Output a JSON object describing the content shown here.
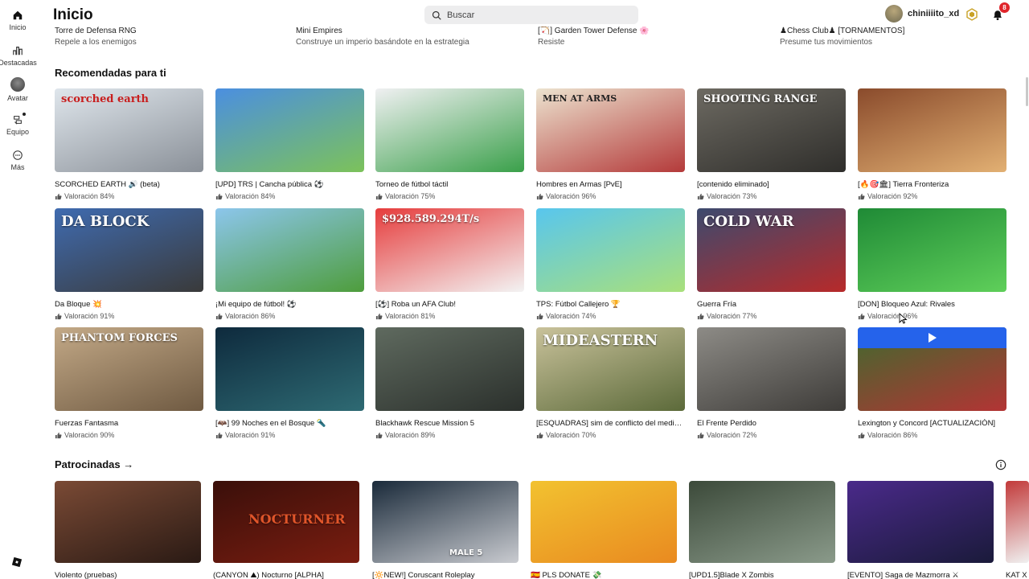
{
  "sidebar": {
    "items": [
      {
        "label": "Inicio",
        "icon": "home-icon"
      },
      {
        "label": "Destacadas",
        "icon": "chart-icon"
      },
      {
        "label": "Avatar",
        "icon": "avatar-icon"
      },
      {
        "label": "Equipo",
        "icon": "team-icon"
      },
      {
        "label": "Más",
        "icon": "more-icon"
      }
    ]
  },
  "header": {
    "title": "Inicio",
    "search_placeholder": "Buscar",
    "username": "chiniiiito_xd",
    "notification_count": "8"
  },
  "top_row": [
    {
      "title": "Torre de Defensa RNG",
      "subtitle": "Repele a los enemigos"
    },
    {
      "title": "Mini Empires",
      "subtitle": "Construye un imperio basándote en la estrategia"
    },
    {
      "title": "[🏹] Garden Tower Defense 🌸",
      "subtitle": "Resiste"
    },
    {
      "title": "♟Chess Club♟ [TORNAMENTOS]",
      "subtitle": "Presume tus movimientos"
    }
  ],
  "recommended": {
    "heading": "Recomendadas para ti",
    "cards": [
      {
        "title": "SCORCHED EARTH 🔊 (beta)",
        "rating": "Valoración 84%",
        "thumb_text": "scorched earth",
        "colors": [
          "#dfe6ec",
          "#8a9098"
        ]
      },
      {
        "title": "[UPD] TRS | Cancha pública ⚽",
        "rating": "Valoración 84%",
        "thumb_text": "",
        "colors": [
          "#4b8fe0",
          "#7cc25a"
        ]
      },
      {
        "title": "Torneo de fútbol táctil",
        "rating": "Valoración 75%",
        "thumb_text": "",
        "colors": [
          "#f0f0f2",
          "#3aa04a"
        ]
      },
      {
        "title": "Hombres en Armas [PvE]",
        "rating": "Valoración 96%",
        "thumb_text": "MEN AT ARMS",
        "colors": [
          "#ece3cf",
          "#b43a3a"
        ]
      },
      {
        "title": "[contenido eliminado]",
        "rating": "Valoración 73%",
        "thumb_text": "SHOOTING RANGE",
        "colors": [
          "#6d6a62",
          "#2f2e2b"
        ]
      },
      {
        "title": "[🔥🎯🏛] Tierra Fronteriza",
        "rating": "Valoración 92%",
        "thumb_text": "",
        "colors": [
          "#8a4b2c",
          "#e2b073"
        ]
      },
      {
        "title": "Da Bloque 💥",
        "rating": "Valoración 91%",
        "thumb_text": "DA BLOCK",
        "colors": [
          "#3f6bb0",
          "#3a3a3a"
        ]
      },
      {
        "title": "¡Mi equipo de fútbol! ⚽",
        "rating": "Valoración 86%",
        "thumb_text": "",
        "colors": [
          "#8cc6ec",
          "#4e9d3c"
        ]
      },
      {
        "title": "[⚽] Roba un AFA Club!",
        "rating": "Valoración 81%",
        "thumb_text": "$928.589.294T/s",
        "colors": [
          "#e63c3c",
          "#f3f3f3"
        ]
      },
      {
        "title": "TPS: Fútbol Callejero 🏆",
        "rating": "Valoración 74%",
        "thumb_text": "",
        "colors": [
          "#58c6ee",
          "#a9e07b"
        ]
      },
      {
        "title": "Guerra Fría",
        "rating": "Valoración 77%",
        "thumb_text": "COLD WAR",
        "colors": [
          "#3c4a6e",
          "#b72a2a"
        ]
      },
      {
        "title": "[DON] Bloqueo Azul: Rivales",
        "rating": "Valoración 96%",
        "thumb_text": "",
        "colors": [
          "#1f8a36",
          "#5fcf5a"
        ]
      },
      {
        "title": "Fuerzas Fantasma",
        "rating": "Valoración 90%",
        "thumb_text": "PHANTOM FORCES",
        "colors": [
          "#c3a987",
          "#6f5a42"
        ]
      },
      {
        "title": "[🦇] 99 Noches en el Bosque 🔦",
        "rating": "Valoración 91%",
        "thumb_text": "",
        "colors": [
          "#0e2a3d",
          "#2e6a73"
        ]
      },
      {
        "title": "Blackhawk Rescue Mission 5",
        "rating": "Valoración 89%",
        "thumb_text": "",
        "colors": [
          "#5f6a5f",
          "#2b302c"
        ]
      },
      {
        "title": "[ESQUADRAS] sim de conflicto del medio oriente",
        "rating": "Valoración 70%",
        "thumb_text": "MIDEASTERN",
        "colors": [
          "#c9c29b",
          "#5c6a3a"
        ]
      },
      {
        "title": "El Frente Perdido",
        "rating": "Valoración 72%",
        "thumb_text": "",
        "colors": [
          "#8d8b86",
          "#3e3c39"
        ]
      },
      {
        "title": "Lexington y Concord [ACTUALIZACIÓN]",
        "rating": "Valoración 86%",
        "thumb_text": "",
        "colors": [
          "#3f6a2e",
          "#b33434"
        ]
      }
    ]
  },
  "sponsored": {
    "heading": "Patrocinadas →",
    "cards": [
      {
        "title": "Violento (pruebas)",
        "thumb_text": "",
        "colors": [
          "#7a4a35",
          "#2a1a14"
        ]
      },
      {
        "title": "(CANYON ⛰) Nocturno [ALPHA]",
        "thumb_text": "NOCTURNER",
        "colors": [
          "#3a0f0a",
          "#7a1d10"
        ]
      },
      {
        "title": "[🔆NEW!] Coruscant Roleplay",
        "thumb_text": "MALE 5",
        "colors": [
          "#1a2a3a",
          "#c9cbd0"
        ]
      },
      {
        "title": "🇪🇸 PLS DONATE 💸",
        "thumb_text": "",
        "colors": [
          "#f2c230",
          "#e98a20"
        ]
      },
      {
        "title": "[UPD1.5]Blade X Zombis",
        "thumb_text": "",
        "colors": [
          "#3c4a3a",
          "#8a9a8a"
        ]
      },
      {
        "title": "[EVENTO] Saga de Mazmorra ⚔",
        "thumb_text": "",
        "colors": [
          "#4a2a8a",
          "#1a1a3a"
        ]
      },
      {
        "title": "KAT X",
        "thumb_text": "",
        "colors": [
          "#c23a3a",
          "#f0f0f0"
        ]
      }
    ]
  }
}
